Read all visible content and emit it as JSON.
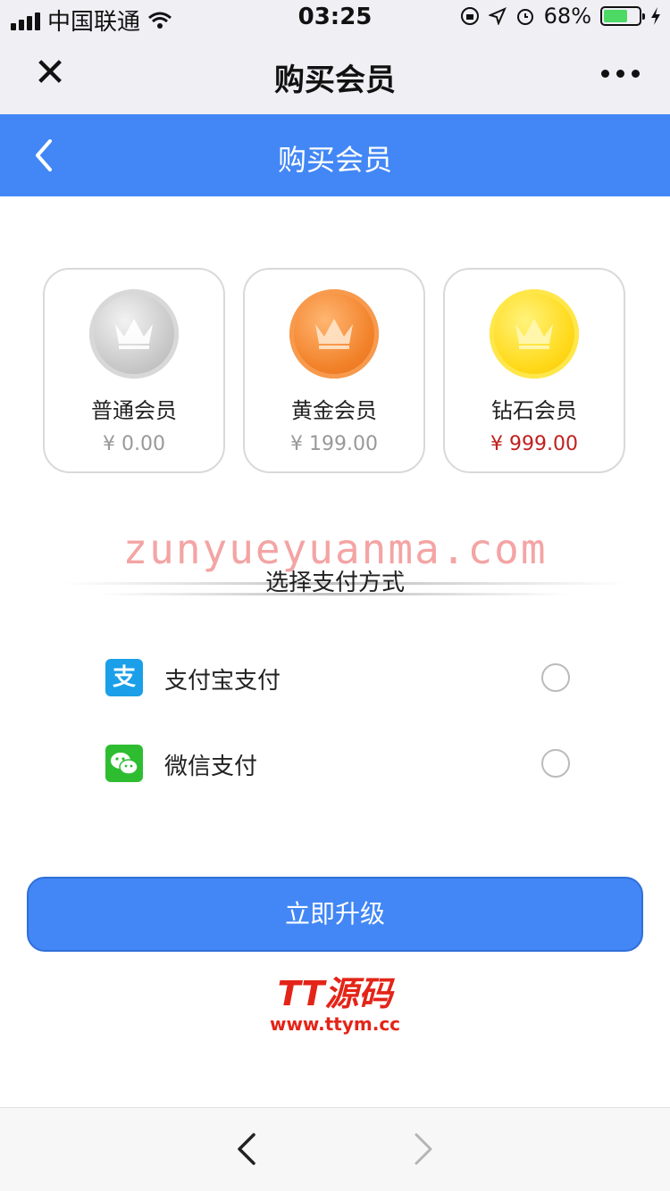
{
  "status_bar": {
    "carrier": "中国联通",
    "time": "03:25",
    "battery": "68%",
    "battery_level": 0.68
  },
  "wechat_nav": {
    "title": "购买会员"
  },
  "header": {
    "title": "购买会员"
  },
  "tiers": [
    {
      "name": "普通会员",
      "price": "¥ 0.00",
      "coin": "silver-crown-coin"
    },
    {
      "name": "黄金会员",
      "price": "¥ 199.00",
      "coin": "bronze-crown-coin"
    },
    {
      "name": "钻石会员",
      "price": "¥ 999.00",
      "coin": "gold-crown-coin"
    }
  ],
  "watermark": "zunyueyuanma.com",
  "payment": {
    "title": "选择支付方式",
    "methods": [
      {
        "label": "支付宝支付",
        "icon": "alipay-icon"
      },
      {
        "label": "微信支付",
        "icon": "wechat-pay-icon"
      }
    ]
  },
  "upgrade_button": "立即升级",
  "brand": {
    "logo": "TT源码",
    "url": "www.ttym.cc"
  },
  "colors": {
    "primary": "#4287f5",
    "price_highlight": "#c0201e",
    "brand_red": "#e42418"
  }
}
